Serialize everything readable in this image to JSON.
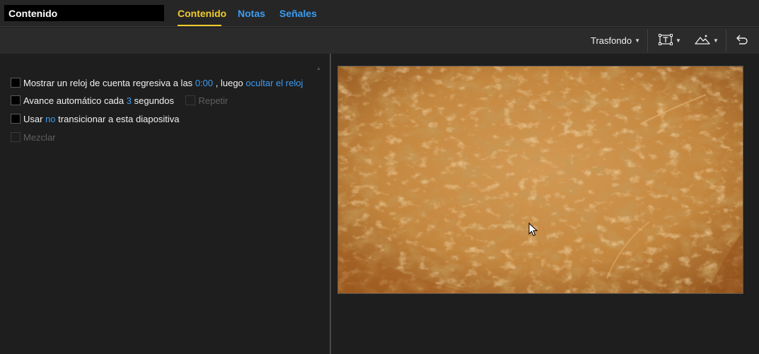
{
  "header": {
    "title_value": "Contenido",
    "tabs": [
      {
        "label": "Contenido",
        "active": true
      },
      {
        "label": "Notas",
        "active": false
      },
      {
        "label": "Señales",
        "active": false
      }
    ]
  },
  "toolbar": {
    "background_label": "Trasfondo",
    "text_icon": "text-box-icon",
    "image_icon": "mountain-image-icon",
    "undo_icon": "undo-arrow-icon"
  },
  "options": {
    "countdown": {
      "prefix": "Mostrar un reloj de cuenta regresiva a las",
      "time": "0:00",
      "middle": ", luego",
      "action": "ocultar el reloj"
    },
    "autoadvance": {
      "prefix": "Avance automático cada",
      "seconds": "3",
      "suffix": "segundos",
      "repeat_label": "Repetir"
    },
    "transition": {
      "prefix": "Usar",
      "value": "no",
      "suffix": "transicionar a esta diapositiva"
    },
    "shuffle_label": "Mezclar"
  },
  "colors": {
    "accent": "#3c9cf2",
    "active_tab": "#f1cc2c",
    "background_texture": "#c58a45"
  }
}
